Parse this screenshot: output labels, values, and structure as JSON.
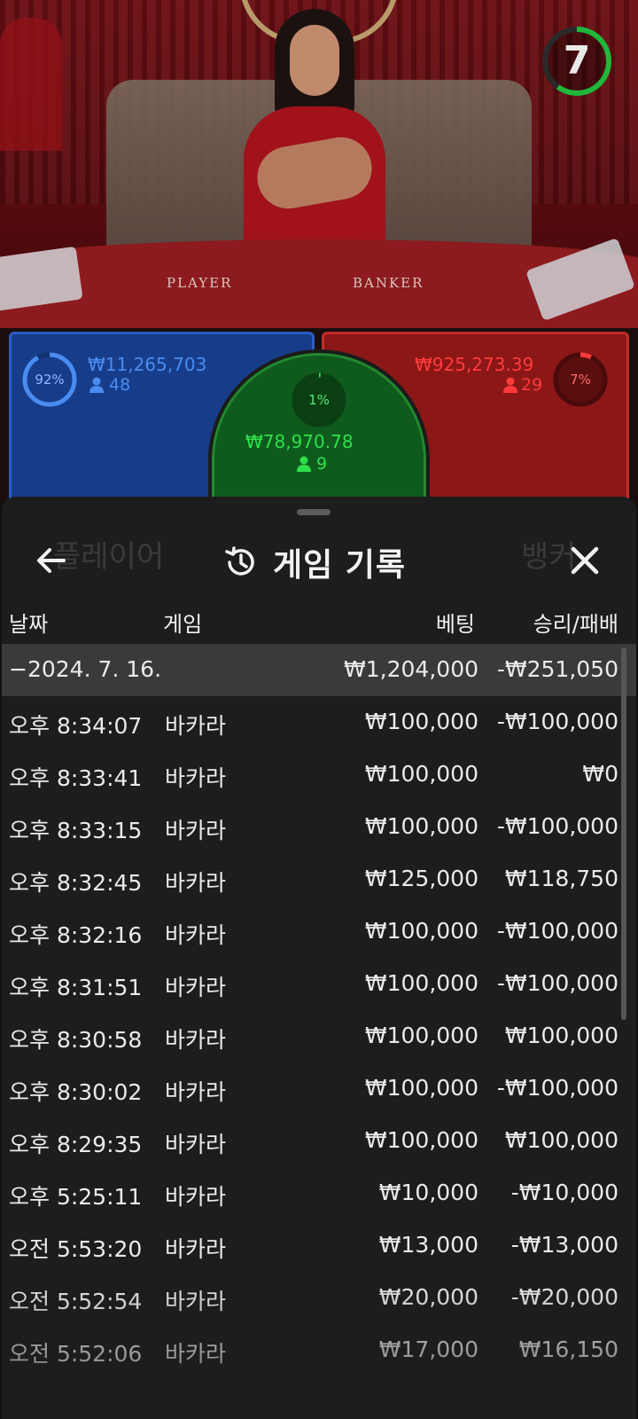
{
  "video": {
    "timer": "7",
    "timer_fraction": 0.6,
    "table_labels": {
      "player": "PLAYER",
      "banker": "BANKER"
    }
  },
  "bets": {
    "player": {
      "percent": "92%",
      "amount": "₩11,265,703",
      "count": "48",
      "color": "#2b5ec0"
    },
    "tie": {
      "percent": "1%",
      "amount": "₩78,970.78",
      "count": "9",
      "color": "#22c43a"
    },
    "banker": {
      "percent": "7%",
      "amount": "₩925,273.39",
      "count": "29",
      "color": "#e03030"
    }
  },
  "sheet": {
    "title": "게임 기록",
    "ghost_left": "플레이어",
    "ghost_right": "뱅커",
    "columns": {
      "date": "날짜",
      "game": "게임",
      "bet": "베팅",
      "win_loss": "승리/패배"
    },
    "summary": {
      "date": "−2024. 7. 16.",
      "bet": "₩1,204,000",
      "win_loss": "-₩251,050"
    },
    "rows": [
      {
        "time": "오후 8:34:07",
        "game": "바카라",
        "bet": "₩100,000",
        "win_loss": "-₩100,000"
      },
      {
        "time": "오후 8:33:41",
        "game": "바카라",
        "bet": "₩100,000",
        "win_loss": "₩0"
      },
      {
        "time": "오후 8:33:15",
        "game": "바카라",
        "bet": "₩100,000",
        "win_loss": "-₩100,000"
      },
      {
        "time": "오후 8:32:45",
        "game": "바카라",
        "bet": "₩125,000",
        "win_loss": "₩118,750"
      },
      {
        "time": "오후 8:32:16",
        "game": "바카라",
        "bet": "₩100,000",
        "win_loss": "-₩100,000"
      },
      {
        "time": "오후 8:31:51",
        "game": "바카라",
        "bet": "₩100,000",
        "win_loss": "-₩100,000"
      },
      {
        "time": "오후 8:30:58",
        "game": "바카라",
        "bet": "₩100,000",
        "win_loss": "₩100,000"
      },
      {
        "time": "오후 8:30:02",
        "game": "바카라",
        "bet": "₩100,000",
        "win_loss": "-₩100,000"
      },
      {
        "time": "오후 8:29:35",
        "game": "바카라",
        "bet": "₩100,000",
        "win_loss": "₩100,000"
      },
      {
        "time": "오후 5:25:11",
        "game": "바카라",
        "bet": "₩10,000",
        "win_loss": "-₩10,000"
      },
      {
        "time": "오전 5:53:20",
        "game": "바카라",
        "bet": "₩13,000",
        "win_loss": "-₩13,000"
      },
      {
        "time": "오전 5:52:54",
        "game": "바카라",
        "bet": "₩20,000",
        "win_loss": "-₩20,000"
      },
      {
        "time": "오전 5:52:06",
        "game": "바카라",
        "bet": "₩17,000",
        "win_loss": "₩16,150"
      }
    ]
  },
  "icons": {
    "back": "arrow-left-icon",
    "close": "close-icon",
    "history": "history-icon",
    "user": "user-icon"
  }
}
